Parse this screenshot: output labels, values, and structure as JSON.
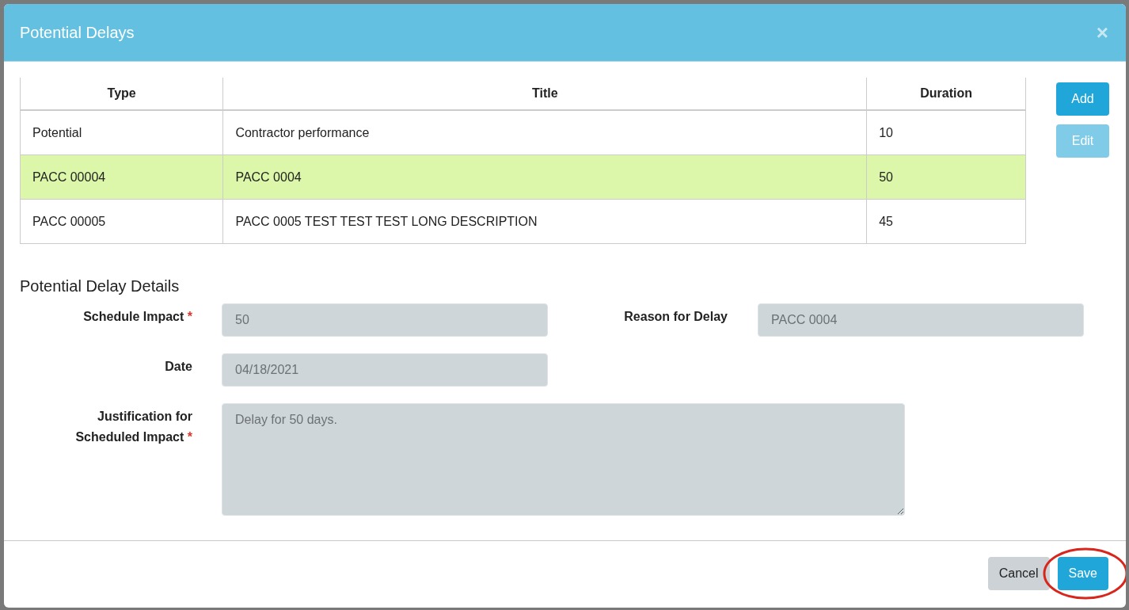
{
  "window": {
    "title": "Potential Delays",
    "close": "×"
  },
  "table": {
    "columns": [
      "Type",
      "Title",
      "Duration"
    ],
    "rows": [
      {
        "cells": [
          "Potential",
          "Contractor performance",
          "10"
        ],
        "selected": false
      },
      {
        "cells": [
          "PACC 00004",
          "PACC 0004",
          "50"
        ],
        "selected": true
      },
      {
        "cells": [
          "PACC 00005",
          "PACC 0005 TEST TEST TEST LONG DESCRIPTION",
          "45"
        ],
        "selected": false
      }
    ]
  },
  "side_buttons": [
    {
      "label": "Add",
      "disabled": false
    },
    {
      "label": "Edit",
      "disabled": true
    }
  ],
  "details": {
    "heading": "Potential Delay Details",
    "fields": [
      {
        "label": "Schedule Impact",
        "required": true,
        "value": "50",
        "kind": "input"
      },
      {
        "label": "Reason for Delay",
        "required": false,
        "value": "PACC 0004",
        "kind": "input"
      },
      {
        "label": "Date",
        "required": false,
        "value": "04/18/2021",
        "kind": "input"
      },
      {
        "label": "Justification for Scheduled Impact",
        "required": true,
        "value": "Delay for 50 days.",
        "kind": "textarea"
      }
    ],
    "required_mark": "*"
  },
  "footer_buttons": [
    {
      "label": "Cancel",
      "kind": "secondary",
      "highlighted": false
    },
    {
      "label": "Save",
      "kind": "primary",
      "highlighted": true
    }
  ]
}
